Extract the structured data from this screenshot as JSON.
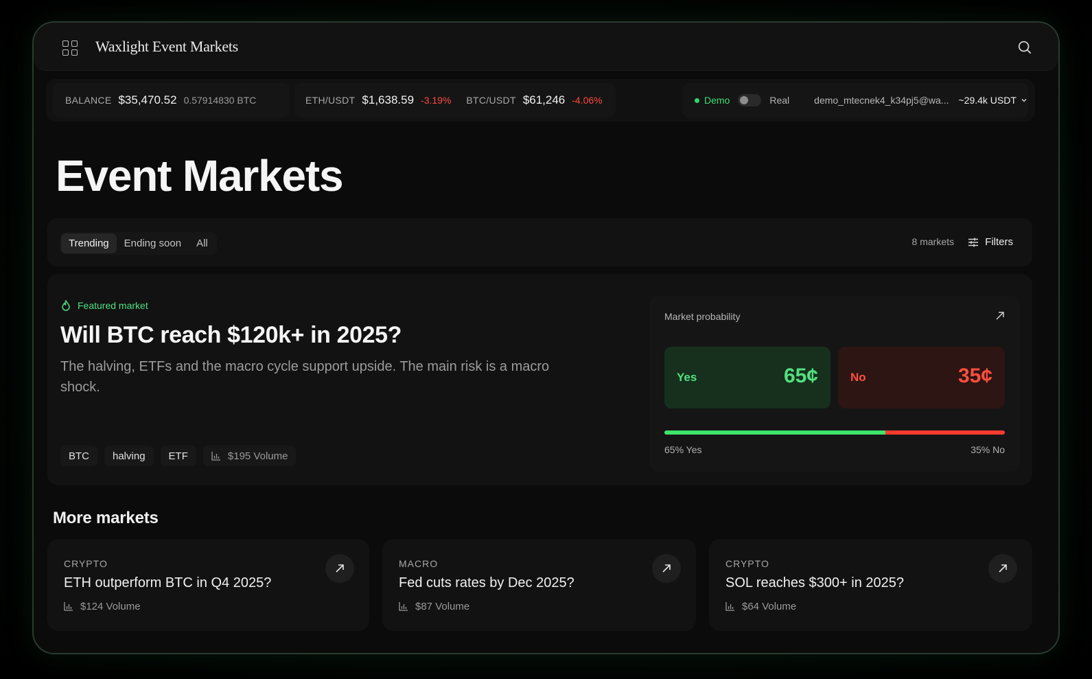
{
  "header": {
    "brand": "Waxlight  Event Markets"
  },
  "status": {
    "balance_label": "BALANCE",
    "balance_value": "$35,470.52",
    "balance_btc": "0.57914830 BTC",
    "tickers": [
      {
        "pair": "ETH/USDT",
        "price": "$1,638.59",
        "change": "-3.19%"
      },
      {
        "pair": "BTC/USDT",
        "price": "$61,246",
        "change": "-4.06%"
      }
    ],
    "mode_demo": "Demo",
    "mode_real": "Real",
    "email": "demo_mtecnek4_k34pj5@wa...",
    "usdt": "~29.4k USDT"
  },
  "page": {
    "title": "Event Markets"
  },
  "filters": {
    "tabs": [
      "Trending",
      "Ending soon",
      "All"
    ],
    "count": "8 markets",
    "filters_label": "Filters"
  },
  "featured": {
    "tag": "Featured market",
    "title": "Will BTC reach $120k+ in 2025?",
    "description": "The halving, ETFs and the macro cycle support upside. The main risk is a macro shock.",
    "chips": [
      "BTC",
      "halving",
      "ETF"
    ],
    "volume": "$195 Volume",
    "prob_title": "Market probability",
    "yes_label": "Yes",
    "yes_price": "65¢",
    "no_label": "No",
    "no_price": "35¢",
    "yes_percent": 65,
    "yes_caption": "65% Yes",
    "no_caption": "35% No"
  },
  "more": {
    "title": "More markets",
    "cards": [
      {
        "category": "CRYPTO",
        "question": "ETH outperform BTC in Q4 2025?",
        "volume": "$124 Volume"
      },
      {
        "category": "MACRO",
        "question": "Fed cuts rates by Dec 2025?",
        "volume": "$87 Volume"
      },
      {
        "category": "CRYPTO",
        "question": "SOL reaches $300+ in 2025?",
        "volume": "$64 Volume"
      }
    ]
  },
  "colors": {
    "accent_green": "#3ee36b",
    "accent_red": "#ff3b30",
    "background": "#0b0b0b"
  }
}
